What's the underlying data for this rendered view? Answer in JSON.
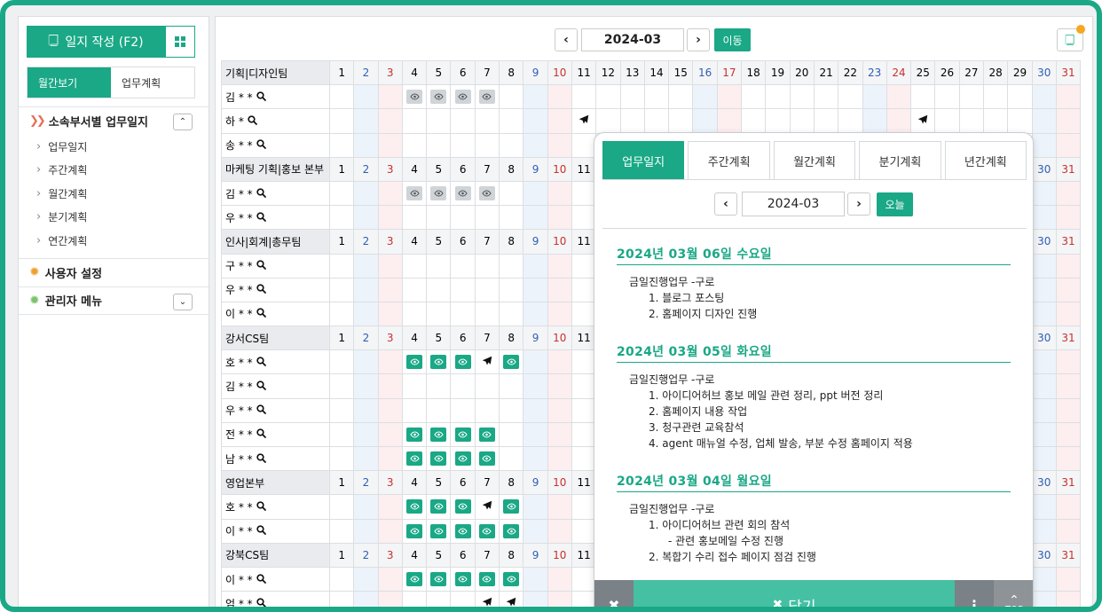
{
  "sidebar": {
    "write_label": "일지 작성 (F2)",
    "tabs": [
      "월간보기",
      "업무계획"
    ],
    "section1": "소속부서별 업무일지",
    "submenu": [
      "업무일지",
      "주간계획",
      "월간계획",
      "분기계획",
      "연간계획"
    ],
    "section2": "사용자 설정",
    "section3": "관리자 메뉴"
  },
  "monthbar": {
    "month": "2024-03",
    "go_label": "이동"
  },
  "calendar": {
    "days": [
      "1",
      "2",
      "3",
      "4",
      "5",
      "6",
      "7",
      "8",
      "9",
      "10",
      "11",
      "12",
      "13",
      "14",
      "15",
      "16",
      "17",
      "18",
      "19",
      "20",
      "21",
      "22",
      "23",
      "24",
      "25",
      "26",
      "27",
      "28",
      "29",
      "30",
      "31"
    ],
    "weekend": {
      "sat": [
        2,
        9,
        16,
        23,
        30
      ],
      "sun": [
        3,
        10,
        17,
        24,
        31
      ]
    },
    "rows": [
      {
        "type": "team",
        "name": "기획|디자인팀"
      },
      {
        "type": "member",
        "name": "김 * *",
        "marks": {
          "4": "eye-grey",
          "5": "eye-grey",
          "6": "eye-grey",
          "7": "eye-grey"
        }
      },
      {
        "type": "member",
        "name": "하 *",
        "marks": {
          "11": "plane",
          "25": "plane"
        }
      },
      {
        "type": "member",
        "name": "송 * *",
        "marks": {}
      },
      {
        "type": "team",
        "name": "마케팅 기획|홍보 본부"
      },
      {
        "type": "member",
        "name": "김 * *",
        "marks": {
          "4": "eye-grey",
          "5": "eye-grey",
          "6": "eye-grey",
          "7": "eye-grey"
        }
      },
      {
        "type": "member",
        "name": "우 * *",
        "marks": {}
      },
      {
        "type": "team",
        "name": "인사|회계|총무팀"
      },
      {
        "type": "member",
        "name": "구 * *",
        "marks": {}
      },
      {
        "type": "member",
        "name": "우 * *",
        "marks": {}
      },
      {
        "type": "member",
        "name": "이 * *",
        "marks": {}
      },
      {
        "type": "team",
        "name": "강서CS팀"
      },
      {
        "type": "member",
        "name": "호 * *",
        "marks": {
          "4": "eye-green",
          "5": "eye-green",
          "6": "eye-green",
          "7": "plane",
          "8": "eye-green"
        }
      },
      {
        "type": "member",
        "name": "김 * *",
        "marks": {}
      },
      {
        "type": "member",
        "name": "우 * *",
        "marks": {}
      },
      {
        "type": "member",
        "name": "전 * *",
        "marks": {
          "4": "eye-green",
          "5": "eye-green",
          "6": "eye-green",
          "7": "eye-green"
        }
      },
      {
        "type": "member",
        "name": "남 * *",
        "marks": {
          "4": "eye-green",
          "5": "eye-green",
          "6": "eye-green",
          "7": "eye-green"
        }
      },
      {
        "type": "team",
        "name": "영업본부"
      },
      {
        "type": "member",
        "name": "호 * *",
        "marks": {
          "4": "eye-green",
          "5": "eye-green",
          "6": "eye-green",
          "7": "plane",
          "8": "eye-green"
        }
      },
      {
        "type": "member",
        "name": "이 * *",
        "marks": {
          "4": "eye-green",
          "5": "eye-green",
          "6": "eye-green",
          "7": "eye-green",
          "8": "eye-green"
        }
      },
      {
        "type": "team",
        "name": "강북CS팀"
      },
      {
        "type": "member",
        "name": "이 * *",
        "marks": {
          "4": "eye-green",
          "5": "eye-green",
          "6": "eye-green",
          "7": "eye-green",
          "8": "eye-green"
        }
      },
      {
        "type": "member",
        "name": "엄 * *",
        "marks": {
          "7": "plane",
          "8": "plane"
        }
      }
    ]
  },
  "popup": {
    "tabs": [
      "업무일지",
      "주간계획",
      "월간계획",
      "분기계획",
      "년간계획"
    ],
    "month": "2024-03",
    "today_label": "오늘",
    "entries": [
      {
        "title": "2024년 03월 06일 수요일",
        "lines": [
          {
            "lvl": 0,
            "text": "금일진행업무 -구로"
          },
          {
            "lvl": 1,
            "text": "1. 블로그 포스팅"
          },
          {
            "lvl": 1,
            "text": "2. 홈페이지 디자인 진행"
          }
        ]
      },
      {
        "title": "2024년 03월 05일 화요일",
        "lines": [
          {
            "lvl": 0,
            "text": "금일진행업무 -구로"
          },
          {
            "lvl": 1,
            "text": "1. 아이디어허브 홍보 메일 관련 정리, ppt 버전 정리"
          },
          {
            "lvl": 1,
            "text": "2. 홈페이지 내용 작업"
          },
          {
            "lvl": 1,
            "text": "3. 청구관련 교육참석"
          },
          {
            "lvl": 1,
            "text": "4. agent 매뉴얼 수정, 업체 발송, 부분 수정 홈페이지 적용"
          }
        ]
      },
      {
        "title": "2024년 03월 04일 월요일",
        "lines": [
          {
            "lvl": 0,
            "text": "금일진행업무 -구로"
          },
          {
            "lvl": 1,
            "text": "1. 아이디어허브 관련 회의 참석"
          },
          {
            "lvl": 2,
            "text": "- 관련 홍보메일 수정 진행"
          },
          {
            "lvl": 1,
            "text": "2. 복합기 수리 접수 페이지 점검 진행"
          }
        ]
      }
    ],
    "close_label": "닫기",
    "top_label": "TOP"
  },
  "colors": {
    "accent": "#1aa886",
    "sat": "#2d5fb5",
    "sun": "#c9302c"
  }
}
